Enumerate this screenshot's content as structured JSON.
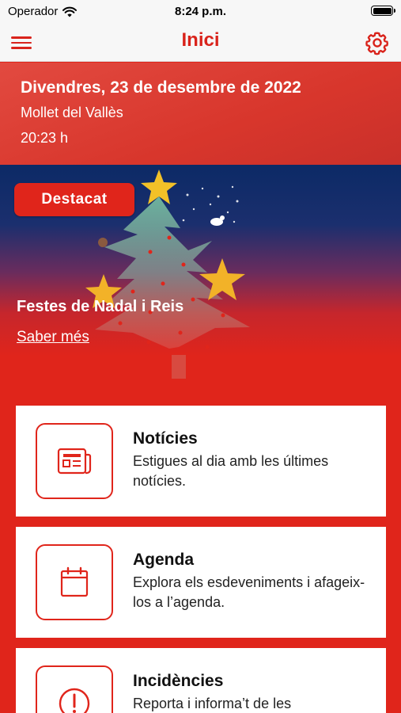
{
  "status_bar": {
    "carrier": "Operador",
    "time": "8:24 p.m.",
    "battery_level": 1.0
  },
  "nav": {
    "title": "Inici",
    "menu_icon": "hamburger-menu-icon",
    "settings_icon": "gear-icon"
  },
  "date_header": {
    "date": "Divendres, 23 de desembre de 2022",
    "location": "Mollet del Vallès",
    "time": "20:23 h"
  },
  "featured": {
    "badge": "Destacat",
    "title": "Festes de Nadal i Reis",
    "link": "Saber més"
  },
  "cards": [
    {
      "title": "Notícies",
      "desc": "Estigues al dia amb les últimes notícies.",
      "icon": "newspaper-icon"
    },
    {
      "title": "Agenda",
      "desc": "Explora els esdeveniments i afageix-los a l’agenda.",
      "icon": "calendar-icon"
    },
    {
      "title": "Incidències",
      "desc": "Reporta i informa’t de les",
      "icon": "alert-icon"
    }
  ],
  "colors": {
    "accent": "#e0251b",
    "nav_bg": "#f7f7f7"
  }
}
